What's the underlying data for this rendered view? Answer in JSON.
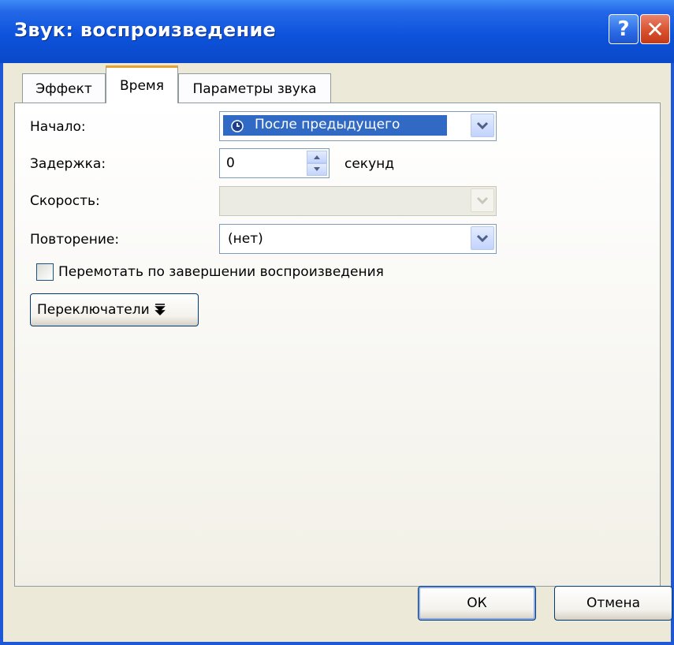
{
  "window": {
    "title": "Звук: воспроизведение",
    "help_label": "?",
    "close_label": "✕"
  },
  "tabs": [
    {
      "label": "Эффект",
      "active": false
    },
    {
      "label": "Время",
      "active": true
    },
    {
      "label": "Параметры звука",
      "active": false
    }
  ],
  "form": {
    "start_label": "Начало:",
    "start_value": "После предыдущего",
    "delay_label": "Задержка:",
    "delay_value": "0",
    "delay_unit": "секунд",
    "speed_label": "Скорость:",
    "speed_value": "",
    "repeat_label": "Повторение:",
    "repeat_value": "(нет)",
    "rewind_label": "Перемотать по завершении воспроизведения",
    "rewind_checked": false,
    "triggers_label": "Переключатели",
    "triggers_icon": "double-chevron-down-icon"
  },
  "buttons": {
    "ok": "ОК",
    "cancel": "Отмена"
  },
  "colors": {
    "titlebar": "#0a48c8",
    "selection": "#316ac5",
    "active_tab_accent": "#e6a233"
  }
}
